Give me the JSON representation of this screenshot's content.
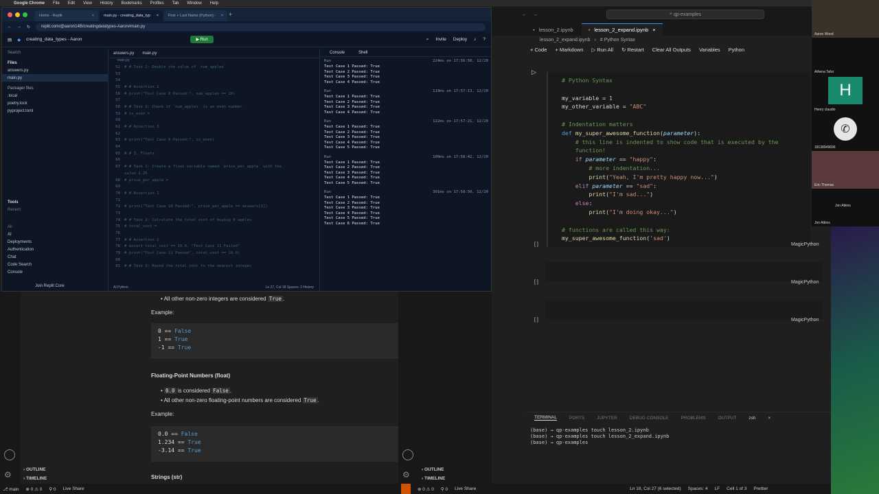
{
  "menubar": {
    "app": "Google Chrome",
    "items": [
      "File",
      "Edit",
      "View",
      "History",
      "Bookmarks",
      "Profiles",
      "Tab",
      "Window",
      "Help"
    ]
  },
  "chrome": {
    "tabs": [
      {
        "label": "Home - Replit"
      },
      {
        "label": "main.py - creating_data_typ"
      },
      {
        "label": "First + Last Name (Python) -"
      }
    ],
    "url": "replit.com/@aaron14B/creatingdatatypes-Aaron#main.py",
    "repl_name": "creating_data_types - Aaron",
    "run": "Run",
    "invite": "Invite",
    "deploy": "Deploy"
  },
  "files": {
    "title": "Files",
    "items": [
      "answers.py",
      "main.py"
    ],
    "packager": "Packager files",
    "pkg_items": [
      ".local",
      "poetry.lock",
      "pyproject.toml"
    ],
    "tools": "Tools",
    "recent": "Recent",
    "all": "All",
    "tool_items": [
      "AI",
      "Deployments",
      "Authentication",
      "Chat",
      "Code Search",
      "Console",
      "Database"
    ],
    "join": "Join Replit Core"
  },
  "editor": {
    "tabs": [
      "answers.py",
      "main.py"
    ],
    "crumb": "main.py",
    "lines": [
      {
        "n": "52",
        "t": "# # Task 2: Double the value of `num_apples`"
      },
      {
        "n": "53",
        "t": ""
      },
      {
        "n": "54",
        "t": ""
      },
      {
        "n": "55",
        "t": "# # Assertion 2"
      },
      {
        "n": "56",
        "t": "# print(\"Test Case 8 Passed:\", num_apples == 20)"
      },
      {
        "n": "57",
        "t": ""
      },
      {
        "n": "58",
        "t": "# # Task 3: Check if `num_apples` is an even number"
      },
      {
        "n": "59",
        "t": "# is_even ="
      },
      {
        "n": "60",
        "t": ""
      },
      {
        "n": "61",
        "t": "# # Assertion 3"
      },
      {
        "n": "62",
        "t": ""
      },
      {
        "n": "63",
        "t": "# print(\"Test Case 9 Passed:\", is_even)"
      },
      {
        "n": "64",
        "t": ""
      },
      {
        "n": "65",
        "t": "# # 3. Floats"
      },
      {
        "n": "66",
        "t": ""
      },
      {
        "n": "67",
        "t": "# # Task 1: Create a float variable named `price_per_apple` with the"
      },
      {
        "n": "",
        "t": "value 1.25"
      },
      {
        "n": "68",
        "t": "# price_per_apple ="
      },
      {
        "n": "69",
        "t": ""
      },
      {
        "n": "70",
        "t": "# # Assertion 1"
      },
      {
        "n": "71",
        "t": ""
      },
      {
        "n": "72",
        "t": "# print(\"Test Case 10 Passed:\", price_per_apple == answers[1])"
      },
      {
        "n": "73",
        "t": ""
      },
      {
        "n": "74",
        "t": "# # Task 2: Calculate the total cost of buying 8 apples"
      },
      {
        "n": "75",
        "t": "# total_cost ="
      },
      {
        "n": "76",
        "t": ""
      },
      {
        "n": "77",
        "t": "# # Assertion 2"
      },
      {
        "n": "78",
        "t": "# assert total_cost == 10.0, \"Test Case 11 Failed\""
      },
      {
        "n": "79",
        "t": "# print(\"Test Case 11 Passed\", total_cost == 10.0)"
      },
      {
        "n": "80",
        "t": ""
      },
      {
        "n": "81",
        "t": "# # Task 3: Round the total cost to the nearest integer"
      }
    ],
    "status_left": "AI  Python",
    "status_right": "Ln 27, Col 18   Spaces: 2   History"
  },
  "console": {
    "tabs": [
      "Console",
      "Shell"
    ],
    "blocks": [
      {
        "meta": "224ms on 17:56:50, 12/20",
        "lines": [
          "Test Case 1 Passed: True",
          "Test Case 2 Passed: True",
          "Test Case 3 Passed: True",
          "Test Case 4 Passed: True"
        ]
      },
      {
        "meta": "119ms on 17:57:13, 12/20",
        "lines": [
          "Test Case 1 Passed: True",
          "Test Case 2 Passed: True",
          "Test Case 3 Passed: True",
          "Test Case 4 Passed: True"
        ]
      },
      {
        "meta": "122ms on 17:57:21, 12/20",
        "lines": [
          "Test Case 1 Passed: True",
          "Test Case 2 Passed: True",
          "Test Case 3 Passed: True",
          "Test Case 4 Passed: True",
          "Test Case 5 Passed: True"
        ]
      },
      {
        "meta": "109ms on 17:58:42, 12/20",
        "lines": [
          "Test Case 1 Passed: True",
          "Test Case 2 Passed: True",
          "Test Case 3 Passed: True",
          "Test Case 4 Passed: True",
          "Test Case 5 Passed: True"
        ]
      },
      {
        "meta": "301ms on 17:58:50, 12/20",
        "lines": [
          "Test Case 1 Passed: True",
          "Test Case 2 Passed: True",
          "Test Case 3 Passed: True",
          "Test Case 4 Passed: True",
          "Test Case 5 Passed: True",
          "Test Case 6 Passed: True"
        ]
      }
    ],
    "run": "Run"
  },
  "vscode": {
    "search": "qp-examples",
    "tabs": [
      "lesson_2.ipynb",
      "lesson_2_expand.ipynb"
    ],
    "breadcrumb": [
      "lesson_2_expand.ipynb",
      "# Python Syntax"
    ],
    "toolbar": [
      "+ Code",
      "+ Markdown",
      "Run All",
      "Restart",
      "Clear All Outputs",
      "Variables",
      "Python"
    ],
    "cell_lang": "MagicPython",
    "terminal_tabs": [
      "TERMINAL",
      "PORTS",
      "JUPYTER",
      "DEBUG CONSOLE",
      "PROBLEMS",
      "OUTPUT"
    ],
    "terminal_shell": "zsh",
    "terminal_lines": [
      "(base) → qp-examples touch lesson_2.ipynb",
      "(base) → qp-examples touch lesson_2_expand.ipynb",
      "(base) → qp-examples "
    ],
    "status": [
      "Ln 18, Col 27 (6 selected)",
      "Spaces: 4",
      "LF",
      "Cell 1 of 3",
      "Prettier"
    ]
  },
  "doc": {
    "bullet_int": "All other non-zero integers are considered",
    "true": "True",
    "false": "False",
    "example": "Example:",
    "int_lines": [
      {
        "a": "0",
        "b": "False"
      },
      {
        "a": "1",
        "b": "True"
      },
      {
        "a": "-1",
        "b": "True"
      }
    ],
    "float_heading": "Floating-Point Numbers (float)",
    "float_b1_pre": "0.0",
    "float_b1_post": "is considered",
    "float_b2": "All other non-zero floating-point numbers are considered",
    "float_lines": [
      {
        "a": "0.0",
        "b": "False"
      },
      {
        "a": "1.234",
        "b": "True"
      },
      {
        "a": "-3.14",
        "b": "True"
      }
    ],
    "strings_heading": "Strings (str)",
    "outline": "OUTLINE",
    "timeline": "TIMELINE"
  },
  "leftstatus": [
    "main",
    "⊗ 0 ⚠ 0",
    "⚲ 0",
    "Live Share"
  ],
  "midstatus": [
    "⊗ 0 ⚠ 0",
    "⚲ 0",
    "Live Share"
  ],
  "zoom": {
    "names": [
      "Aaron Wood",
      "Athena Tafur",
      "Henry claudio",
      "18138949696",
      "Eric Thomas",
      "Jon Atkins",
      "Jon Atkins"
    ],
    "initial": "H"
  }
}
